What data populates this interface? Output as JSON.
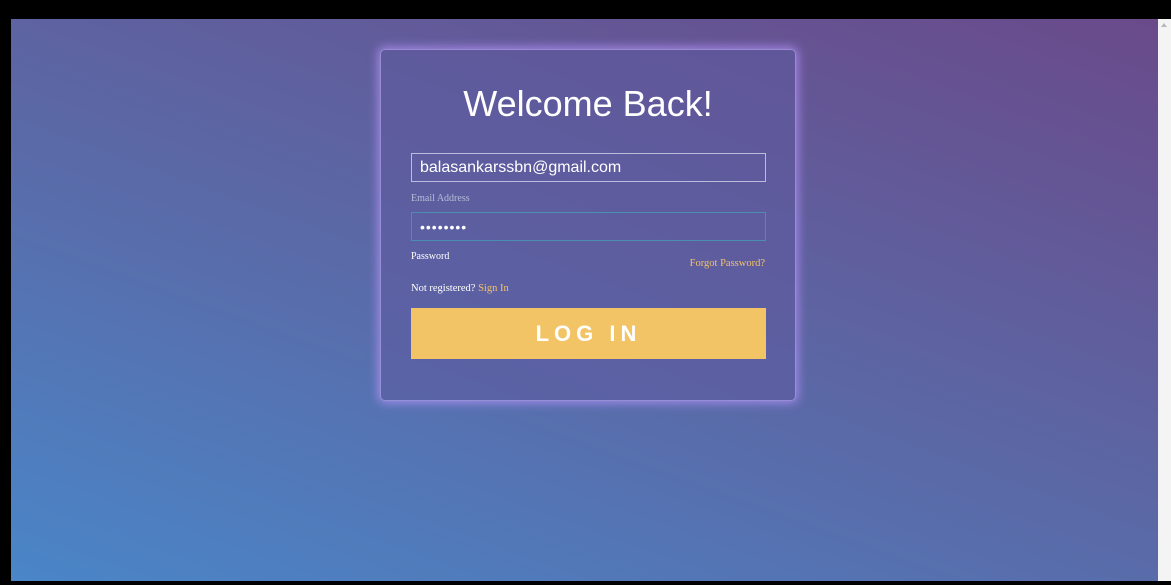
{
  "colors": {
    "accent": "#f2c466",
    "link": "#f2c26a",
    "background_start": "#4a86c8",
    "background_end": "#6a4a8a"
  },
  "login": {
    "title": "Welcome Back!",
    "email": {
      "value": "balasankarssbn@gmail.com",
      "label": "Email Address"
    },
    "password": {
      "value": "••••••••",
      "label": "Password"
    },
    "forgot_password": "Forgot Password?",
    "register_prompt": "Not registered?",
    "sign_in_link": "Sign In",
    "submit_label": "LOG IN"
  }
}
